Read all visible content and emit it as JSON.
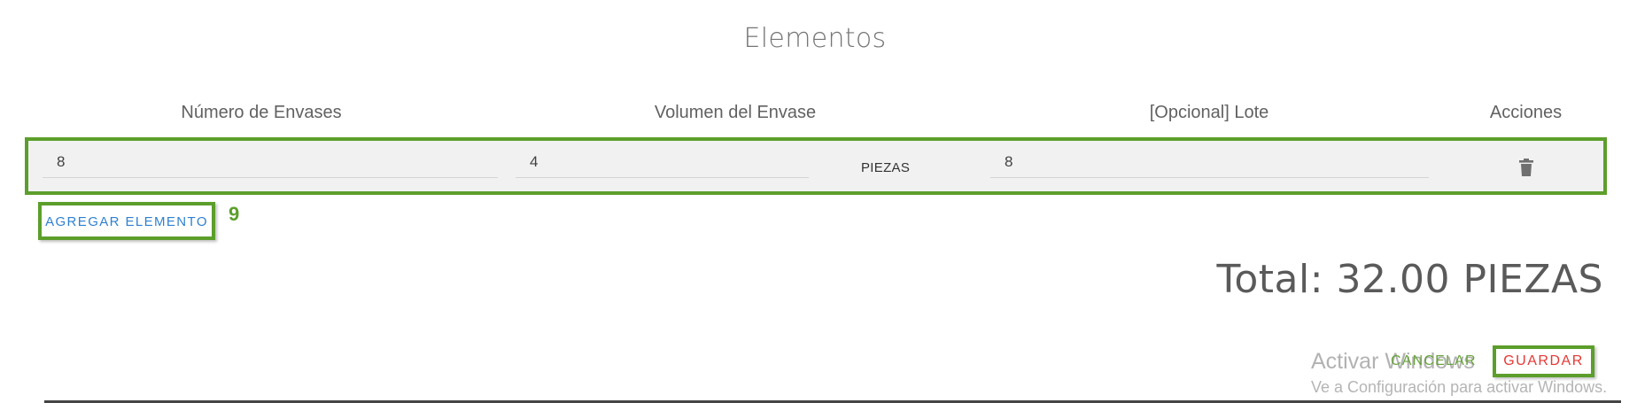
{
  "section": {
    "title": "Elementos"
  },
  "table": {
    "headers": [
      "Número de Envases",
      "Volumen del Envase",
      "[Opcional] Lote",
      "Acciones"
    ],
    "rows": [
      {
        "numero_envases": "8",
        "volumen_envase": "4",
        "unidad": "PIEZAS",
        "lote": "8",
        "action_icon": "trash-icon"
      }
    ]
  },
  "actions": {
    "add_element": "AGREGAR ELEMENTO",
    "step_marker": "9",
    "cancel": "CANCELAR",
    "save": "GUARDAR"
  },
  "summary": {
    "total": "Total: 32.00 PIEZAS"
  },
  "watermark": {
    "line1": "Activar Windows",
    "line2": "Ve a Configuración para activar Windows."
  },
  "colors": {
    "highlight": "#5c9e2b",
    "link": "#2f80d1",
    "danger": "#e53935",
    "row_bg": "#f1f1f1"
  }
}
